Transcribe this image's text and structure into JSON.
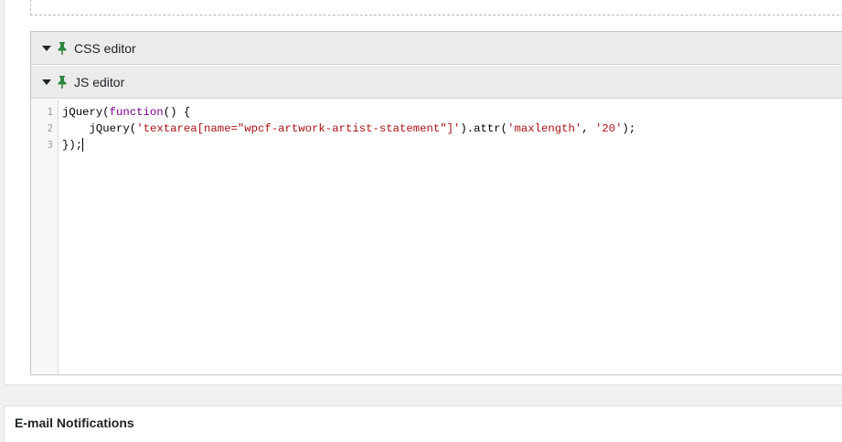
{
  "css_editor": {
    "label": "CSS editor",
    "toggle_icon": "triangle-down",
    "pin_icon": "pin",
    "pin_color": "#2e8540"
  },
  "js_editor": {
    "label": "JS editor",
    "toggle_icon": "triangle-down",
    "pin_icon": "pin",
    "line_numbers": [
      "1",
      "2",
      "3"
    ],
    "line1": {
      "a": "jQuery(",
      "kw": "function",
      "b": "() {"
    },
    "line2": {
      "indent": "    ",
      "a": "jQuery(",
      "s1": "'textarea[name=\"wpcf-artwork-artist-statement\"]'",
      "b": ").attr(",
      "s2": "'maxlength'",
      "c": ", ",
      "s3": "'20'",
      "d": ");"
    },
    "line3": {
      "a": "});"
    }
  },
  "email_notifications": {
    "title": "E-mail Notifications"
  },
  "colors": {
    "keyword": "#770088",
    "string": "#aa1111",
    "header_bg": "#ebebeb"
  }
}
